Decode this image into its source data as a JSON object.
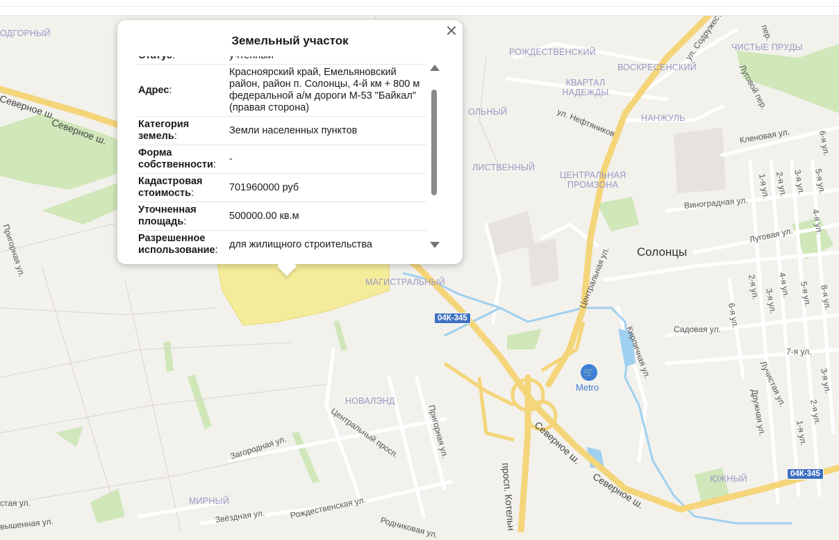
{
  "popup": {
    "title": "Земельный участок",
    "close_icon": "close-icon",
    "rows": [
      {
        "key": "Статус",
        "value": "учтенный"
      },
      {
        "key": "Адрес",
        "value": "Красноярский край, Емельяновский район, район п. Солонцы, 4-й км + 800 м федеральной а/м дороги М-53 \"Байкал\" (правая сторона)"
      },
      {
        "key": "Категория земель",
        "value": "Земли населенных пунктов"
      },
      {
        "key": "Форма собственности",
        "value": "-"
      },
      {
        "key": "Кадастровая стоимость",
        "value": "701960000 руб"
      },
      {
        "key": "Уточненная площадь",
        "value": "500000.00 кв.м"
      },
      {
        "key": "Разрешенное использование",
        "value": "для жилищного строительства"
      }
    ],
    "scroll_position": 0.1
  },
  "map": {
    "districts": [
      "ОДГОРНЫЙ",
      "РОЖДЕСТВЕНСКИЙ",
      "ВОСКРЕСЕНСКИЙ",
      "ЧИСТЫЕ ПРУДЫ",
      "КВАРТАЛ НАДЕЖДЫ",
      "НАНЖУЛЬ",
      "ОЛЬНЫЙ",
      "ЛИСТВЕННЫЙ",
      "ЦЕНТРАЛЬНАЯ ПРОМЗОНА",
      "МАГИСТРАЛЬНЫЙ",
      "НОВАЛЭНД",
      "МИРНЫЙ",
      "ЮЖНЫЙ"
    ],
    "town": "Солонцы",
    "streets": [
      "Северное ш.",
      "Северное ш.",
      "Северное ш.",
      "Северное ш.",
      "ул. Содружества",
      "пер.",
      "Луговой пер.",
      "ул. Нефтяников",
      "Кленовая ул.",
      "Виноградная ул.",
      "Луговая ул.",
      "Центральная ул.",
      "Садовая ул.",
      "Кирпичная ул.",
      "7-я ул.",
      "Лучистая ул.",
      "Дружная ул.",
      "Пригорная ул.",
      "Пригорная ул.",
      "Центральный просп.",
      "Загородная ул.",
      "просп. Котельн",
      "Звёздная ул.",
      "Рождественская ул.",
      "Родниковая ул.",
      "стая ул.",
      "вышенная ул.",
      "6-я ул.",
      "5-я ул.",
      "4-я ул.",
      "1-я ул.",
      "2-я ул.",
      "3-я ул.",
      "2-я ул.",
      "3-я ул.",
      "4-я ул.",
      "5-я ул.",
      "8-я ул.",
      "6-я ул.",
      "3-я ул.",
      "2-я ул.",
      "1-я ул."
    ],
    "road_shields": [
      "04К-345",
      "04К-345"
    ],
    "poi": {
      "icon": "shopping-cart-icon",
      "label": "Metro"
    },
    "colors": {
      "parcel": "#f5ec9a",
      "water": "#9fd0ef",
      "highway": "#f4d57a",
      "green": "#cfe7b9",
      "district_label": "#9a97c4",
      "shield": "#3d6fc2"
    }
  }
}
